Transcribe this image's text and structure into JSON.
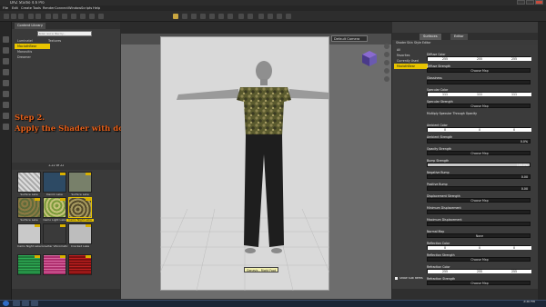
{
  "window": {
    "title": "DAZ Studio 4.6 Pro"
  },
  "menubar": {
    "items": [
      "File",
      "Edit",
      "Create",
      "Tools",
      "Render",
      "Connect",
      "Window",
      "Scripts",
      "Help"
    ]
  },
  "content_library": {
    "tabs": [
      "Content Library"
    ],
    "search_placeholder": "Enter text to filter by...",
    "tree": [
      {
        "label": "Luminatel",
        "selected": false
      },
      {
        "label": "MaclothBear",
        "selected": true
      },
      {
        "label": "Monovitis",
        "selected": false
      },
      {
        "label": "Dreamer",
        "selected": false
      }
    ],
    "folder_label": "Textures",
    "pager": "1-22 of 22",
    "thumbnails": [
      {
        "label": "Surface Lake",
        "selected": false
      },
      {
        "label": "Denim Lake",
        "selected": false
      },
      {
        "label": "Surface Lake",
        "selected": false
      },
      {
        "label": "Surface Lake",
        "selected": false
      },
      {
        "label": "Camo Light Lake",
        "selected": false
      },
      {
        "label": "Camo Night Lake",
        "selected": true
      },
      {
        "label": "Camo Night Lake",
        "selected": false
      },
      {
        "label": "Gravitar Vibromatic",
        "selected": false
      },
      {
        "label": "Cracked Lake",
        "selected": false
      },
      {
        "label": "",
        "selected": false
      },
      {
        "label": "",
        "selected": false
      },
      {
        "label": "",
        "selected": false
      }
    ]
  },
  "overlay": {
    "line1": "Step 2.",
    "line2": "Apply the Shader with double click."
  },
  "viewport": {
    "camera": "Default Camera",
    "tooltip": "Genesis - Right Foot",
    "coord_label": "1:1"
  },
  "surfaces": {
    "tabs": [
      "Surfaces",
      "Editor"
    ],
    "subtabs": [
      "Shader",
      "Skin",
      "Style",
      "Editor"
    ],
    "scene_items": [
      {
        "label": "All",
        "selected": false
      },
      {
        "label": "Favorites",
        "selected": false
      },
      {
        "label": "Currently Used",
        "selected": false
      },
      {
        "label": "MaclothBear",
        "selected": true
      }
    ],
    "properties": [
      {
        "label": "Diffuse Color",
        "type": "color",
        "values": [
          "255",
          "255",
          "255"
        ]
      },
      {
        "label": "Diffuse Strength",
        "type": "map",
        "map": "Choose Map"
      },
      {
        "label": "Glossiness",
        "type": "slider",
        "value": "",
        "fill": 0.0
      },
      {
        "label": "Specular Color",
        "type": "color",
        "values": [
          "111",
          "111",
          "111"
        ]
      },
      {
        "label": "Specular Strength",
        "type": "map",
        "map": "Choose Map"
      },
      {
        "label": "Multiply Specular Through Opacity",
        "type": "text"
      },
      {
        "label": "Ambient Color",
        "type": "color",
        "values": [
          "0",
          "0",
          "0"
        ]
      },
      {
        "label": "Ambient Strength",
        "type": "slider",
        "value": "0.0%",
        "fill": 0.0
      },
      {
        "label": "Opacity Strength",
        "type": "map",
        "map": "Choose Map"
      },
      {
        "label": "Bump Strength",
        "type": "slider",
        "value": "100.0%",
        "fill": 1.0
      },
      {
        "label": "Negative Bump",
        "type": "slider",
        "value": "0.00",
        "fill": 0.0
      },
      {
        "label": "Positive Bump",
        "type": "slider",
        "value": "0.00",
        "fill": 0.0
      },
      {
        "label": "Displacement Strength",
        "type": "map",
        "map": "Choose Map"
      },
      {
        "label": "Minimum Displacement",
        "type": "slider",
        "value": "",
        "fill": 0.0
      },
      {
        "label": "Maximum Displacement",
        "type": "slider",
        "value": "",
        "fill": 0.0
      },
      {
        "label": "Normal Map",
        "type": "map",
        "map": "None"
      },
      {
        "label": "Reflection Color",
        "type": "color",
        "values": [
          "0",
          "0",
          "0"
        ]
      },
      {
        "label": "Reflection Strength",
        "type": "map",
        "map": "Choose Map"
      },
      {
        "label": "Refraction Color",
        "type": "color",
        "values": [
          "255",
          "255",
          "255"
        ]
      },
      {
        "label": "Refraction Strength",
        "type": "map",
        "map": "Choose Map"
      }
    ],
    "show_sub_items": "Show Sub Items"
  },
  "taskbar": {
    "clock": "3:30 PM"
  }
}
